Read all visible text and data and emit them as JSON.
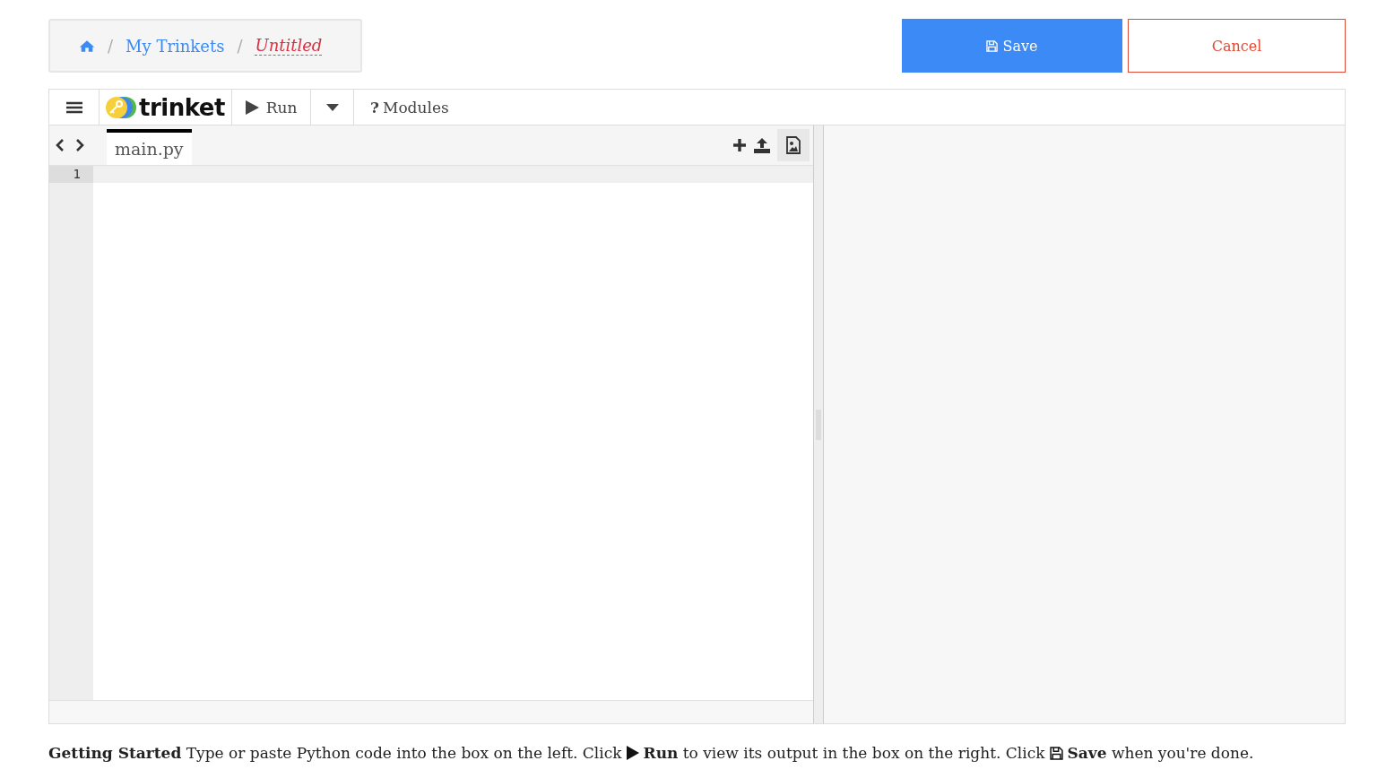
{
  "breadcrumb": {
    "items": [
      "My Trinkets"
    ],
    "current": "Untitled",
    "separator": "/"
  },
  "actions": {
    "save": "Save",
    "cancel": "Cancel"
  },
  "toolbar": {
    "logo": "trinket",
    "run": "Run",
    "modules": "Modules",
    "help_mark": "?"
  },
  "editor": {
    "tabs": [
      {
        "label": "main.py",
        "selected": true
      }
    ],
    "line_numbers": [
      "1"
    ]
  },
  "getting_started": [
    "**Getting Started** Type or paste Python code into the box on the left. Click",
    "**Run** to view its output in the box on the right. Click",
    "**Save** when you're done."
  ]
}
